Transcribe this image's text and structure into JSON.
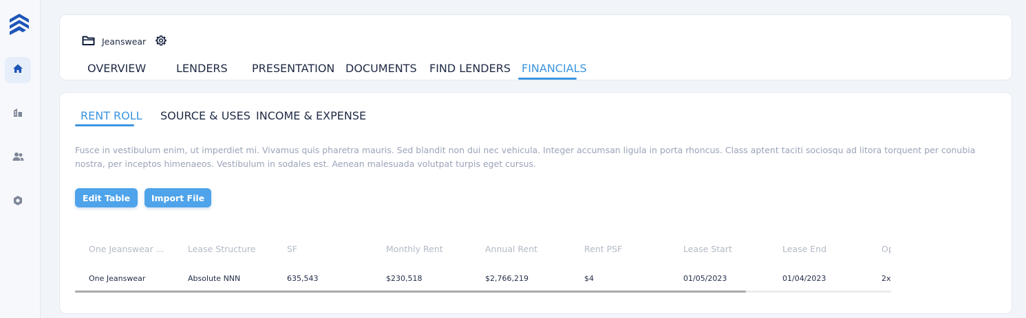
{
  "project": {
    "name": "Jeanswear",
    "folder_icon": "folder-icon",
    "settings_icon": "gear-icon"
  },
  "nav": [
    "home-icon",
    "buildings-icon",
    "users-icon",
    "settings-hex-icon"
  ],
  "main_tabs": [
    "OVERVIEW",
    "LENDERS",
    "PRESENTATION",
    "DOCUMENTS",
    "FIND LENDERS",
    "FINANCIALS"
  ],
  "sub_tabs": [
    "RENT ROLL",
    "SOURCE & USES",
    "INCOME & EXPENSE"
  ],
  "description": "Fusce in vestibulum enim, ut imperdiet mi. Vivamus quis pharetra mauris. Sed blandit non dui nec vehicula. Integer accumsan ligula in porta rhoncus. Class aptent taciti sociosqu ad litora torquent per conubia nostra, per inceptos himenaeos. Vestibulum in sodales est. Aenean malesuada volutpat turpis eget cursus.",
  "buttons": {
    "edit": "Edit Table",
    "import": "Import File"
  },
  "table": {
    "headers": [
      "One Jeanswear ...",
      "Lease Structure",
      "SF",
      "Monthly Rent",
      "Annual Rent",
      "Rent PSF",
      "Lease Start",
      "Lease End",
      "Op"
    ],
    "rows": [
      [
        "One Jeanswear",
        "Absolute NNN",
        "635,543",
        "$230,518",
        "$2,766,219",
        "$4",
        "01/05/2023",
        "01/04/2023",
        "2x"
      ]
    ]
  },
  "colors": {
    "accent": "#3b95e0",
    "button": "#4ea3ea",
    "brand": "#1e56b8"
  }
}
